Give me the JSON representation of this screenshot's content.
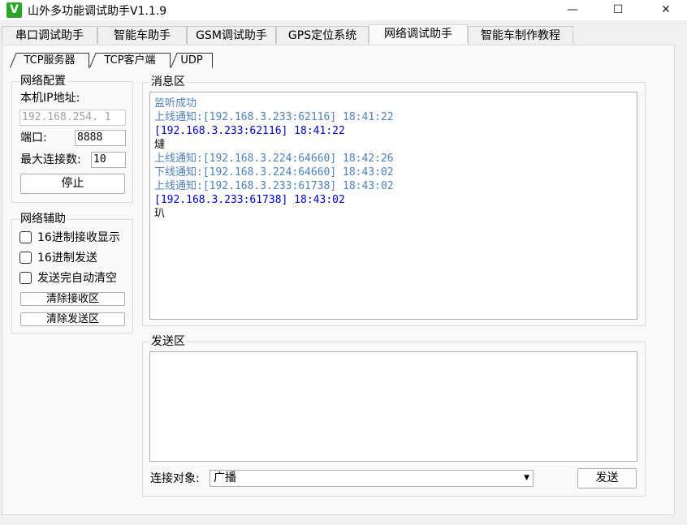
{
  "window": {
    "app_icon": "V",
    "title": "山外多功能调试助手V1.1.9",
    "minimize_glyph": "—",
    "maximize_glyph": "☐",
    "close_glyph": "✕"
  },
  "main_tabs": [
    "串口调试助手",
    "智能车助手",
    "GSM调试助手",
    "GPS定位系统",
    "网络调试助手",
    "智能车制作教程"
  ],
  "active_main_tab": "网络调试助手",
  "sub_tabs": [
    "TCP服务器",
    "TCP客户端",
    "UDP"
  ],
  "active_sub_tab": "TCP服务器",
  "network_config": {
    "legend": "网络配置",
    "ip_label": "本机IP地址:",
    "ip_value": "192.168.254. 1",
    "port_label": "端口:",
    "port_value": "8888",
    "maxconn_label": "最大连接数:",
    "maxconn_value": "10",
    "stop_label": "停止"
  },
  "network_aux": {
    "legend": "网络辅助",
    "hex_receive_label": "16进制接收显示",
    "hex_send_label": "16进制发送",
    "auto_clear_label": "发送完自动清空",
    "hex_receive_checked": false,
    "hex_send_checked": false,
    "auto_clear_checked": false,
    "clear_receive_label": "清除接收区",
    "clear_send_label": "清除发送区"
  },
  "message_area": {
    "legend": "消息区",
    "lines": [
      {
        "text": "监听成功",
        "color": "#4f81bd"
      },
      {
        "text": "上线通知:[192.168.3.233:62116] 18:41:22",
        "color": "#4f81bd"
      },
      {
        "text": "[192.168.3.233:62116] 18:41:22",
        "color": "#0000cc"
      },
      {
        "text": "燵",
        "color": "#000000"
      },
      {
        "text": "上线通知:[192.168.3.224:64660] 18:42:26",
        "color": "#4f81bd"
      },
      {
        "text": "下线通知:[192.168.3.224:64660] 18:43:02",
        "color": "#4f81bd"
      },
      {
        "text": "上线通知:[192.168.3.233:61738] 18:43:02",
        "color": "#4f81bd"
      },
      {
        "text": "[192.168.3.233:61738] 18:43:02",
        "color": "#0000cc"
      },
      {
        "text": "玐",
        "color": "#000000"
      }
    ]
  },
  "send_area": {
    "legend": "发送区",
    "content": "",
    "target_label": "连接对象:",
    "target_value": "广播",
    "send_label": "发送"
  },
  "colors": {
    "info_line": "#4f81bd",
    "data_line": "#0000cc",
    "app_icon_bg": "#2aa52a"
  }
}
